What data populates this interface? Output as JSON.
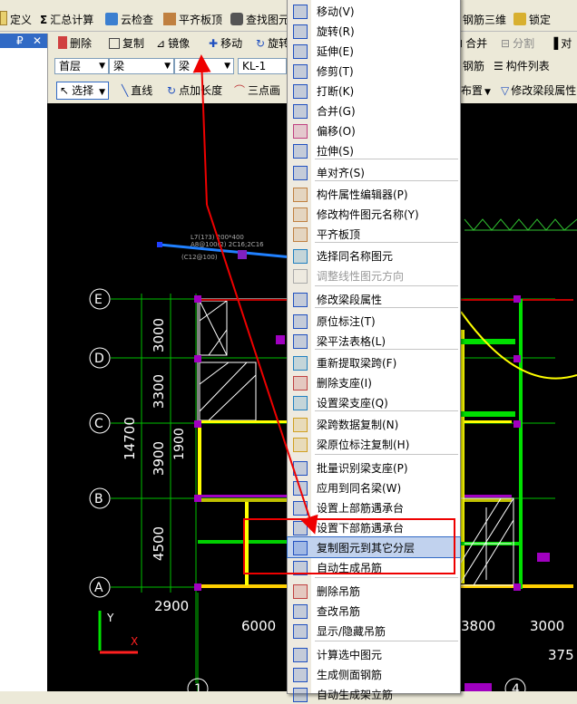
{
  "toolbar1": {
    "define": "定义",
    "calc": "汇总计算",
    "cloud_check": "云检查",
    "flat_board": "平齐板顶",
    "find_element": "查找图元",
    "steel_3d": "钢筋三维",
    "lock": "锁定"
  },
  "toolbar2": {
    "delete": "删除",
    "copy": "复制",
    "mirror": "镜像",
    "move": "移动",
    "rotate": "旋转",
    "merge": "合并",
    "split": "分割",
    "align": "对"
  },
  "selectors": {
    "floor": "首层",
    "category": "梁",
    "type": "梁",
    "element": "KL-1"
  },
  "toolbar3": {
    "select": "选择",
    "line": "直线",
    "point_length": "点加长度",
    "three_point": "三点画",
    "layout": "布置",
    "modify_span_attr": "修改梁段属性",
    "steel": "钢筋",
    "component_list": "构件列表"
  },
  "drawing": {
    "beam_label_1": "L7(1?3) 200*400",
    "beam_label_2": "A8@100(2) 2C16;2C16",
    "beam_label_3": "(C12@100)",
    "axes_rows": [
      "E",
      "D",
      "C",
      "B",
      "A"
    ],
    "axes_cols": [
      "1",
      "4"
    ],
    "dims_vertical": [
      "3000",
      "3300",
      "3900",
      "4500"
    ],
    "dim_total": "14700",
    "dim_inner": "1900",
    "dims_horizontal": [
      "2900",
      "6000",
      "3800",
      "3000",
      "375"
    ],
    "coord_y": "Y",
    "coord_x": "X"
  },
  "context_menu": {
    "items": [
      {
        "label": "移动(V)",
        "icon": "move-icon"
      },
      {
        "label": "旋转(R)",
        "icon": "rotate-icon"
      },
      {
        "label": "延伸(E)",
        "icon": "extend-icon"
      },
      {
        "label": "修剪(T)",
        "icon": "trim-icon"
      },
      {
        "label": "打断(K)",
        "icon": "break-icon"
      },
      {
        "label": "合并(G)",
        "icon": "merge-icon"
      },
      {
        "label": "偏移(O)",
        "icon": "offset-icon"
      },
      {
        "label": "拉伸(S)",
        "icon": "stretch-icon"
      },
      {
        "label": "单对齐(S)",
        "icon": "align-icon"
      },
      {
        "label": "构件属性编辑器(P)",
        "icon": "property-editor-icon"
      },
      {
        "label": "修改构件图元名称(Y)",
        "icon": "rename-icon"
      },
      {
        "label": "平齐板顶",
        "icon": "flat-board-icon"
      },
      {
        "label": "选择同名称图元",
        "icon": "select-same-icon"
      },
      {
        "label": "调整线性图元方向",
        "icon": "direction-icon"
      },
      {
        "label": "修改梁段属性",
        "icon": "beam-attr-icon"
      },
      {
        "label": "原位标注(T)",
        "icon": "annotate-icon"
      },
      {
        "label": "梁平法表格(L)",
        "icon": "table-icon"
      },
      {
        "label": "重新提取梁跨(F)",
        "icon": "extract-span-icon"
      },
      {
        "label": "删除支座(I)",
        "icon": "delete-support-icon"
      },
      {
        "label": "设置梁支座(Q)",
        "icon": "set-support-icon"
      },
      {
        "label": "梁跨数据复制(N)",
        "icon": "brush-icon"
      },
      {
        "label": "梁原位标注复制(H)",
        "icon": "brush-icon"
      },
      {
        "label": "批量识别梁支座(P)",
        "icon": "batch-icon"
      },
      {
        "label": "应用到同名梁(W)",
        "icon": "apply-icon"
      },
      {
        "label": "设置上部筋遇承台",
        "icon": "upper-steel-icon"
      },
      {
        "label": "设置下部筋遇承台",
        "icon": "lower-steel-icon"
      },
      {
        "label": "复制图元到其它分层",
        "icon": "copy-layer-icon"
      },
      {
        "label": "自动生成吊筋",
        "icon": "auto-hanger-icon"
      },
      {
        "label": "删除吊筋",
        "icon": "delete-hanger-icon"
      },
      {
        "label": "查改吊筋",
        "icon": "edit-hanger-icon"
      },
      {
        "label": "显示/隐藏吊筋",
        "icon": "toggle-hanger-icon"
      },
      {
        "label": "计算选中图元",
        "icon": "calc-icon"
      },
      {
        "label": "生成侧面钢筋",
        "icon": "side-steel-icon"
      },
      {
        "label": "自动生成架立筋",
        "icon": "auto-icon"
      }
    ]
  },
  "colors": {
    "menu_highlight": "#c1d2ee",
    "annotation_red": "#e00000",
    "cad_background": "#000000"
  }
}
